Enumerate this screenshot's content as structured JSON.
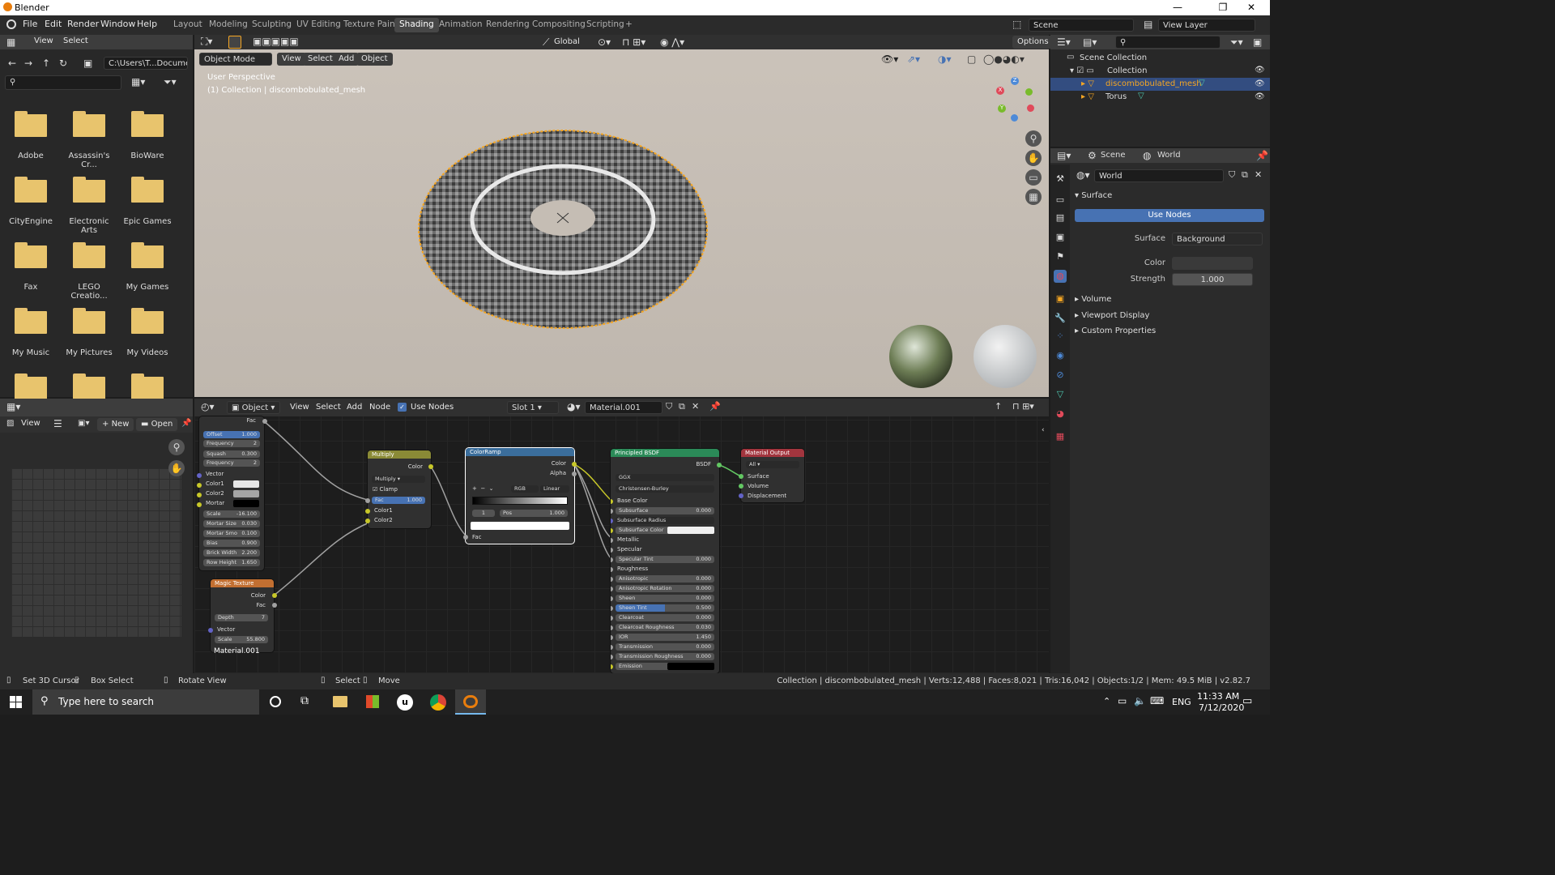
{
  "app": {
    "title": "Blender",
    "min": "—",
    "max": "❐",
    "close": "✕"
  },
  "menu": {
    "file": "File",
    "edit": "Edit",
    "render": "Render",
    "window": "Window",
    "help": "Help"
  },
  "workspaces": [
    "Layout",
    "Modeling",
    "Sculpting",
    "UV Editing",
    "Texture Paint",
    "Shading",
    "Animation",
    "Rendering",
    "Compositing",
    "Scripting",
    "+"
  ],
  "scene": {
    "name": "Scene",
    "view_layer": "View Layer"
  },
  "filebrowser": {
    "view": "View",
    "select": "Select",
    "path": "C:\\Users\\T...Documents\\",
    "folders": [
      "Adobe",
      "Assassin's Cr...",
      "BioWare",
      "CityEngine",
      "Electronic Arts",
      "Epic Games",
      "Fax",
      "LEGO Creatio...",
      "My Games",
      "My Music",
      "My Pictures",
      "My Videos"
    ]
  },
  "viewport": {
    "mode": "Object Mode",
    "view": "View",
    "select": "Select",
    "add": "Add",
    "object": "Object",
    "orientation": "Global",
    "options": "Options",
    "overlay1": "User Perspective",
    "overlay2": "(1) Collection | discombobulated_mesh"
  },
  "outliner": {
    "scene_collection": "Scene Collection",
    "collection": "Collection",
    "items": [
      "discombobulated_mesh",
      "Torus"
    ]
  },
  "properties": {
    "scene": "Scene",
    "world": "World",
    "world_name": "World",
    "surface_header": "Surface",
    "use_nodes": "Use Nodes",
    "surface_label": "Surface",
    "surface_value": "Background",
    "color_label": "Color",
    "strength_label": "Strength",
    "strength_value": "1.000",
    "panels": [
      "Volume",
      "Viewport Display",
      "Custom Properties"
    ]
  },
  "image_editor": {
    "view": "View",
    "new": "New",
    "open": "Open"
  },
  "node_editor": {
    "object": "Object",
    "view": "View",
    "select": "Select",
    "add": "Add",
    "node": "Node",
    "use_nodes": "Use Nodes",
    "slot": "Slot 1",
    "material": "Material.001",
    "footer_label": "Material.001"
  },
  "nodes": {
    "brick": {
      "fac": "Fac",
      "offset": "Offset",
      "offset_v": "1.000",
      "frequency": "Frequency",
      "frequency_v": "2",
      "squash": "Squash",
      "squash_v": "0.300",
      "frequency2": "Frequency",
      "frequency2_v": "2",
      "vector": "Vector",
      "color1": "Color1",
      "color2": "Color2",
      "mortar": "Mortar",
      "scale": "Scale",
      "scale_v": "-16.100",
      "mortar_size": "Mortar Size",
      "mortar_size_v": "0.030",
      "mortar_smooth": "Mortar Smo",
      "mortar_smooth_v": "0.100",
      "bias": "Bias",
      "bias_v": "0.900",
      "brick_width": "Brick Width",
      "brick_width_v": "2.200",
      "row_height": "Row Height",
      "row_height_v": "1.650"
    },
    "multiply": {
      "title": "Multiply",
      "color": "Color",
      "op": "Multiply",
      "clamp": "Clamp",
      "fac": "Fac",
      "fac_v": "1.000",
      "color1": "Color1",
      "color2": "Color2"
    },
    "colorramp": {
      "title": "ColorRamp",
      "color": "Color",
      "alpha": "Alpha",
      "mode": "RGB",
      "interp": "Linear",
      "index": "1",
      "pos": "Pos",
      "pos_v": "1.000",
      "fac": "Fac"
    },
    "magic": {
      "title": "Magic Texture",
      "color": "Color",
      "fac": "Fac",
      "depth": "Depth",
      "depth_v": "7",
      "vector": "Vector",
      "scale": "Scale",
      "scale_v": "55.800"
    },
    "bsdf": {
      "title": "Principled BSDF",
      "bsdf": "BSDF",
      "dist": "GGX",
      "sss": "Christensen-Burley",
      "base_color": "Base Color",
      "rows": [
        [
          "Subsurface",
          "0.000"
        ],
        [
          "Subsurface Radius",
          ""
        ],
        [
          "Subsurface Color",
          ""
        ],
        [
          "Metallic",
          ""
        ],
        [
          "Specular",
          ""
        ],
        [
          "Specular Tint",
          "0.000"
        ],
        [
          "Roughness",
          ""
        ],
        [
          "Anisotropic",
          "0.000"
        ],
        [
          "Anisotropic Rotation",
          "0.000"
        ],
        [
          "Sheen",
          "0.000"
        ],
        [
          "Sheen Tint",
          "0.500"
        ],
        [
          "Clearcoat",
          "0.000"
        ],
        [
          "Clearcoat Roughness",
          "0.030"
        ],
        [
          "IOR",
          "1.450"
        ],
        [
          "Transmission",
          "0.000"
        ],
        [
          "Transmission Roughness",
          "0.000"
        ],
        [
          "Emission",
          ""
        ]
      ]
    },
    "output": {
      "title": "Material Output",
      "target": "All",
      "surface": "Surface",
      "volume": "Volume",
      "displacement": "Displacement"
    }
  },
  "statusbar": {
    "cursor": "Set 3D Cursor",
    "box": "Box Select",
    "rotate": "Rotate View",
    "select": "Select",
    "move": "Move",
    "stats": "Collection | discombobulated_mesh | Verts:12,488 | Faces:8,021 | Tris:16,042 | Objects:1/2 | Mem: 49.5 MiB | v2.82.7"
  },
  "taskbar": {
    "search": "Type here to search",
    "lang": "ENG",
    "time": "11:33 AM",
    "date": "7/12/2020"
  },
  "colors": {
    "accent": "#4772b3",
    "orange": "#f5a623",
    "folder": "#e8c46d"
  }
}
